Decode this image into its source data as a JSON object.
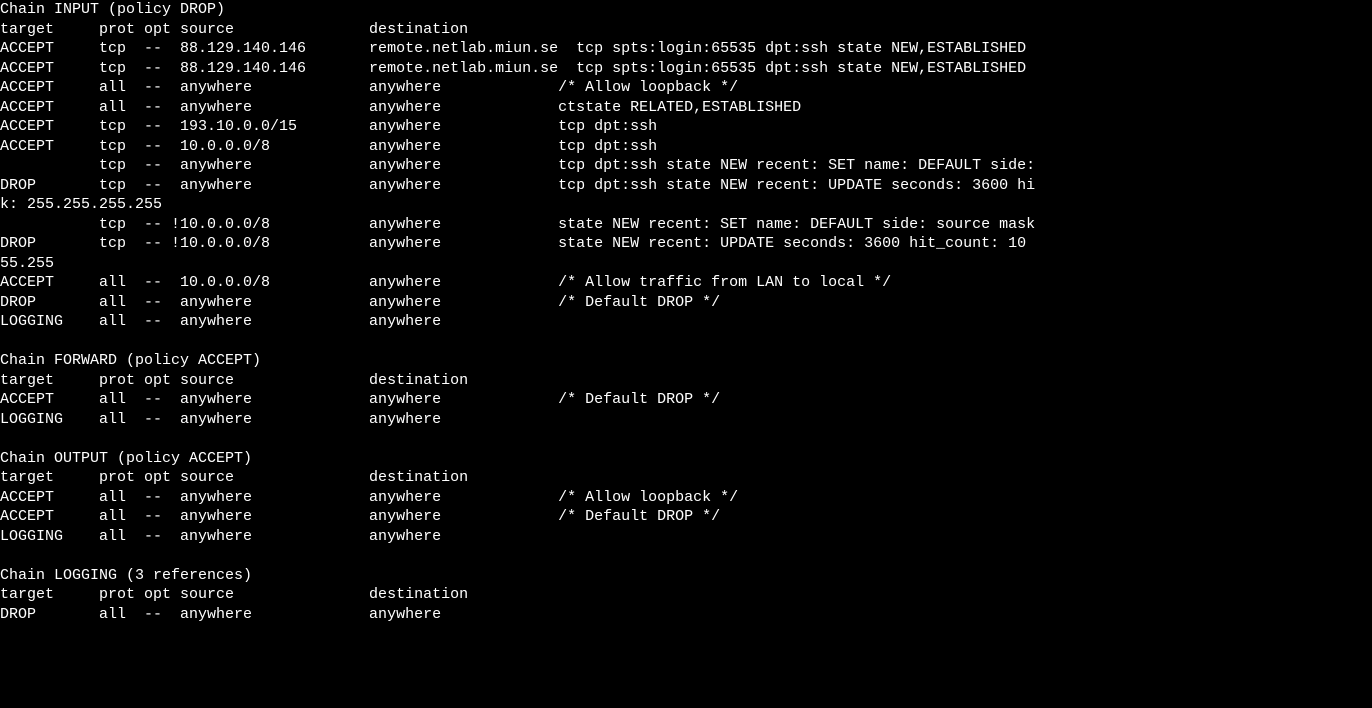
{
  "chains": {
    "input": {
      "header": "Chain INPUT (policy DROP)",
      "columns": "target     prot opt source               destination",
      "rules": [
        "ACCEPT     tcp  --  88.129.140.146       remote.netlab.miun.se  tcp spts:login:65535 dpt:ssh state NEW,ESTABLISHED",
        "ACCEPT     tcp  --  88.129.140.146       remote.netlab.miun.se  tcp spts:login:65535 dpt:ssh state NEW,ESTABLISHED",
        "ACCEPT     all  --  anywhere             anywhere             /* Allow loopback */",
        "ACCEPT     all  --  anywhere             anywhere             ctstate RELATED,ESTABLISHED",
        "ACCEPT     tcp  --  193.10.0.0/15        anywhere             tcp dpt:ssh",
        "ACCEPT     tcp  --  10.0.0.0/8           anywhere             tcp dpt:ssh",
        "           tcp  --  anywhere             anywhere             tcp dpt:ssh state NEW recent: SET name: DEFAULT side:",
        "DROP       tcp  --  anywhere             anywhere             tcp dpt:ssh state NEW recent: UPDATE seconds: 3600 hi",
        "k: 255.255.255.255",
        "           tcp  -- !10.0.0.0/8           anywhere             state NEW recent: SET name: DEFAULT side: source mask",
        "DROP       tcp  -- !10.0.0.0/8           anywhere             state NEW recent: UPDATE seconds: 3600 hit_count: 10 ",
        "55.255",
        "ACCEPT     all  --  10.0.0.0/8           anywhere             /* Allow traffic from LAN to local */",
        "DROP       all  --  anywhere             anywhere             /* Default DROP */",
        "LOGGING    all  --  anywhere             anywhere"
      ]
    },
    "forward": {
      "header": "Chain FORWARD (policy ACCEPT)",
      "columns": "target     prot opt source               destination",
      "rules": [
        "ACCEPT     all  --  anywhere             anywhere             /* Default DROP */",
        "LOGGING    all  --  anywhere             anywhere"
      ]
    },
    "output": {
      "header": "Chain OUTPUT (policy ACCEPT)",
      "columns": "target     prot opt source               destination",
      "rules": [
        "ACCEPT     all  --  anywhere             anywhere             /* Allow loopback */",
        "ACCEPT     all  --  anywhere             anywhere             /* Default DROP */",
        "LOGGING    all  --  anywhere             anywhere"
      ]
    },
    "logging": {
      "header": "Chain LOGGING (3 references)",
      "columns": "target     prot opt source               destination",
      "rules": [
        "DROP       all  --  anywhere             anywhere"
      ]
    }
  }
}
